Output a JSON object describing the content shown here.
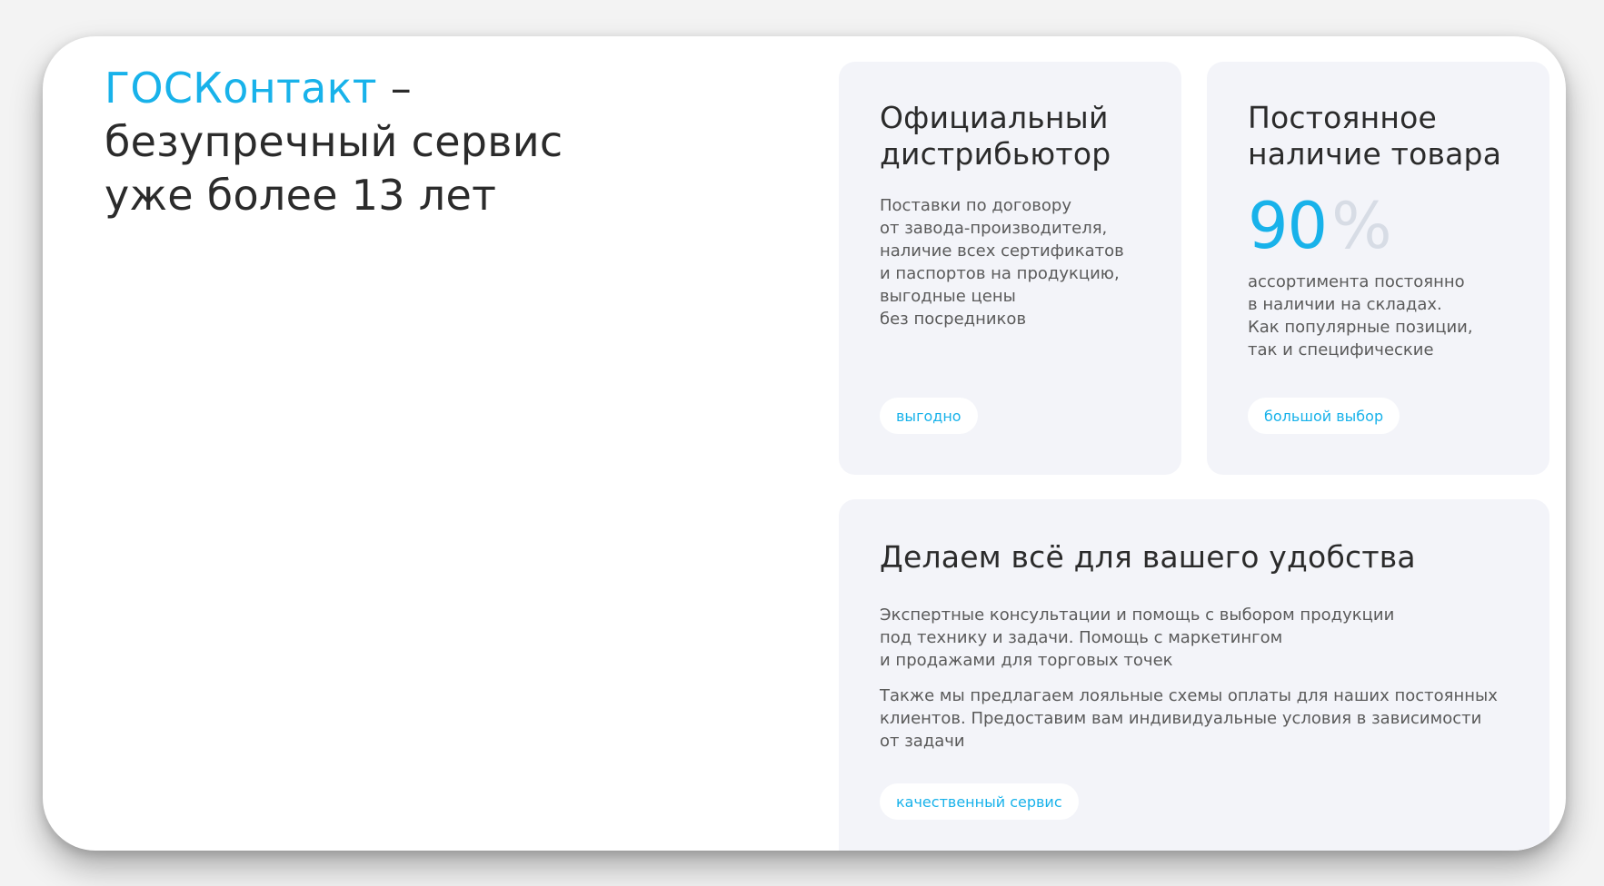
{
  "hero": {
    "brand": "ГОСКонтакт",
    "dash": "–",
    "line_2": "безупречный сервис",
    "line_3": "уже более 13 лет"
  },
  "cards": [
    {
      "title": "Официальный\nдистрибьютор",
      "text": "Поставки по договору\nот завода-производителя,\nналичие всех сертификатов\nи паспортов на продукцию,\nвыгодные цены\nбез посредников",
      "badge": "выгодно"
    },
    {
      "title": "Постоянное\nналичие товара",
      "metric": {
        "value": "90",
        "unit": "%"
      },
      "text": "ассортимента постоянно\nв наличии на складах.\nКак популярные позиции,\nтак и специфические",
      "badge": "большой выбор"
    },
    {
      "title": "Делаем всё для вашего удобства",
      "text_1": "Экспертные консультации и помощь с выбором продукции\nпод технику и задачи. Помощь с маркетингом\nи продажами для торговых точек",
      "text_2": "Также мы предлагаем лояльные схемы оплаты для наших постоянных\nклиентов. Предоставим вам индивидуальные условия в зависимости\nот задачи",
      "badge": "качественный сервис"
    }
  ],
  "colors": {
    "accent": "#18b2ea",
    "card_background": "#f3f4f9",
    "text": "#2b2b2b",
    "muted_text": "#5a5a5a",
    "metric_unit": "#d7dce5"
  }
}
